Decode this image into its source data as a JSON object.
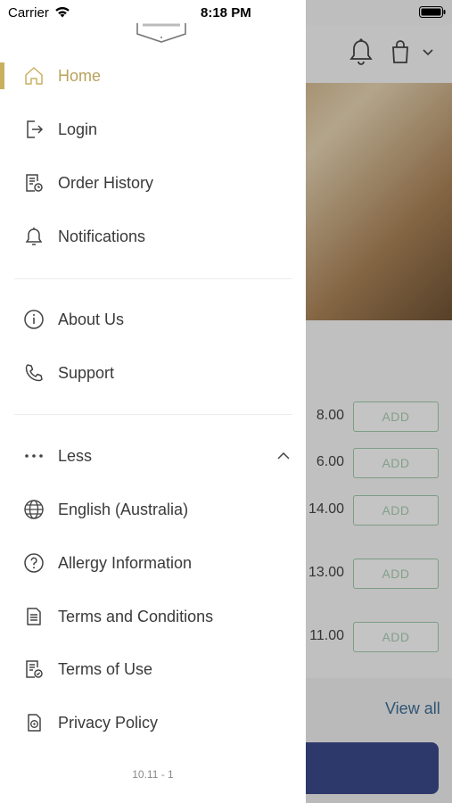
{
  "status_bar": {
    "carrier": "Carrier",
    "time": "8:18 PM"
  },
  "menu": {
    "home": "Home",
    "login": "Login",
    "order_history": "Order History",
    "notifications": "Notifications",
    "about_us": "About Us",
    "support": "Support",
    "less": "Less",
    "language": "English (Australia)",
    "allergy": "Allergy Information",
    "terms_conditions": "Terms and Conditions",
    "terms_use": "Terms of Use",
    "privacy": "Privacy Policy"
  },
  "version": "10.11 - 1",
  "background": {
    "prices": [
      "8.00",
      "6.00",
      "14.00",
      "13.00",
      "11.00"
    ],
    "add_label": "ADD",
    "view_all": "View all"
  },
  "colors": {
    "accent": "#c9b060",
    "add_border": "#9fc9aa",
    "cta": "#3b4a8a",
    "link": "#3e6d96"
  },
  "icons": [
    "wifi-icon",
    "battery-icon",
    "home-icon",
    "login-icon",
    "order-history-icon",
    "bell-icon",
    "info-icon",
    "phone-icon",
    "more-icon",
    "chevron-up-icon",
    "globe-icon",
    "help-icon",
    "document-icon",
    "document-check-icon",
    "privacy-icon",
    "bag-icon",
    "chevron-down-icon"
  ]
}
